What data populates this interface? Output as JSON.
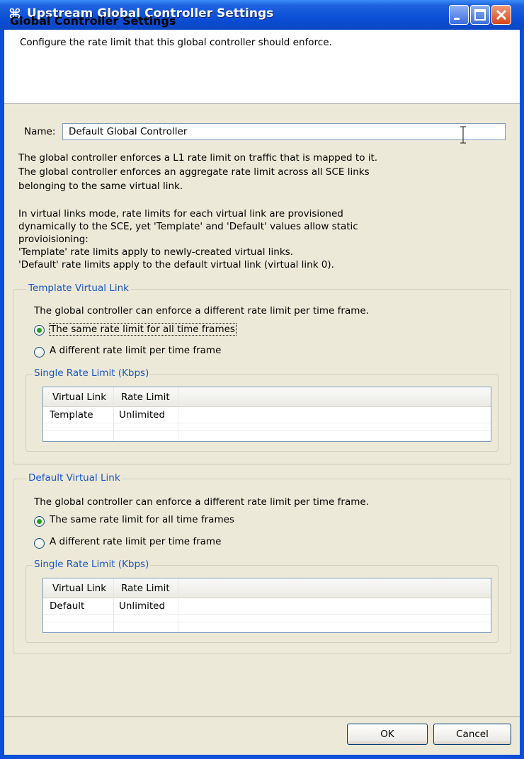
{
  "window": {
    "title": "Upstream Global Controller Settings"
  },
  "header": {
    "title": "Global Controller Settings",
    "description": "Configure the rate limit that this global controller should enforce."
  },
  "name_field": {
    "label": "Name:",
    "value": "Default Global Controller"
  },
  "info": {
    "para1": [
      "The global controller enforces a L1 rate limit on traffic that is mapped to it.",
      "The global controller enforces an aggregate rate limit across all SCE links",
      "belonging to the same virtual link."
    ],
    "para2": [
      "In virtual links mode, rate limits for each virtual link are provisioned",
      "dynamically to the SCE, yet 'Template' and 'Default' values allow static",
      "provioisioning:",
      "'Template' rate limits apply to newly-created virtual links.",
      "'Default' rate limits apply to the default virtual link (virtual link 0)."
    ]
  },
  "template_group": {
    "title": "Template Virtual Link",
    "intro": "The global controller can enforce a different rate limit per time frame.",
    "option_same": "The same rate limit for all time frames",
    "option_different": "A different rate limit per time frame",
    "selected": "same",
    "subgroup_title": "Single Rate Limit (Kbps)",
    "columns": [
      "Virtual Link",
      "Rate Limit"
    ],
    "rows": [
      [
        "Template",
        "Unlimited"
      ]
    ]
  },
  "default_group": {
    "title": "Default Virtual Link",
    "intro": "The global controller can enforce a different rate limit per time frame.",
    "option_same": "The same rate limit for all time frames",
    "option_different": "A different rate limit per time frame",
    "selected": "same",
    "subgroup_title": "Single Rate Limit (Kbps)",
    "columns": [
      "Virtual Link",
      "Rate Limit"
    ],
    "rows": [
      [
        "Default",
        "Unlimited"
      ]
    ]
  },
  "buttons": {
    "ok": "OK",
    "cancel": "Cancel"
  }
}
